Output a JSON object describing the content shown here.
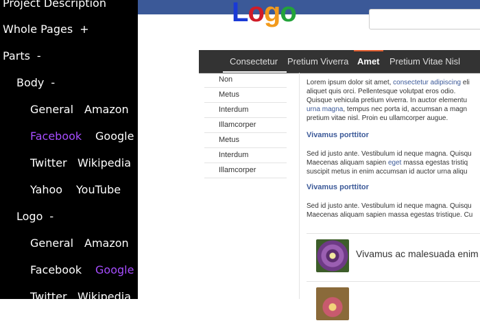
{
  "sidenav": {
    "project": "Project Description",
    "whole_pages": {
      "label": "Whole Pages",
      "toggle": "+"
    },
    "parts": {
      "label": "Parts",
      "toggle": "-"
    },
    "body": {
      "label": "Body",
      "toggle": "-"
    },
    "body_items": [
      {
        "a": "General",
        "b": "Amazon"
      },
      {
        "a": "Facebook",
        "b": "Google"
      },
      {
        "a": "Twitter",
        "b": "Wikipedia"
      },
      {
        "a": "Yahoo",
        "b": "YouTube"
      }
    ],
    "logo": {
      "label": "Logo",
      "toggle": "-"
    },
    "logo_items": [
      {
        "a": "General",
        "b": "Amazon"
      },
      {
        "a": "Facebook",
        "b": "Google"
      },
      {
        "a": "Twitter",
        "b": "Wikipedia"
      }
    ],
    "active_color": "#a64dff"
  },
  "header": {
    "logo_letters": [
      "L",
      "o",
      "g",
      "o"
    ],
    "brand_color": "#3b5998"
  },
  "tabs": [
    {
      "label": "Consectetur"
    },
    {
      "label": "Pretium Viverra"
    },
    {
      "label": "Amet"
    },
    {
      "label": "Pretium Vitae Nisl"
    }
  ],
  "submenu": [
    "Non",
    "Metus",
    "Interdum",
    "Illamcorper",
    "Metus",
    "Interdum",
    "Illamcorper"
  ],
  "content": {
    "intro_lines": [
      "Lorem ipsum dolor sit amet, ",
      "consectetur adipiscing",
      " eli",
      "aliquet quis orci. Pellentesque volutpat eros odio.",
      "Quisque vehicula pretium viverra. In auctor elementu",
      "urna magna",
      ", tempus nec porta id, accumsan a magn",
      "pretium vitae nisl. Proin eu ullamcorper augue."
    ],
    "section1": {
      "heading": "Vivamus porttitor",
      "lines": [
        "Sed id justo ante. Vestibulum id neque magna. Quisqu",
        "Maecenas aliquam sapien ",
        "eget",
        " massa egestas tristiq",
        "suscipit metus in enim accumsan id auctor urna aliqu"
      ]
    },
    "section2": {
      "heading": "Vivamus porttitor",
      "lines": [
        "Sed id justo ante. Vestibulum id neque magna. Quisqu",
        "Maecenas aliquam sapien massa egestas tristique. Cu"
      ]
    },
    "cards": [
      {
        "title": "Vivamus ac malesuada enim"
      }
    ]
  }
}
